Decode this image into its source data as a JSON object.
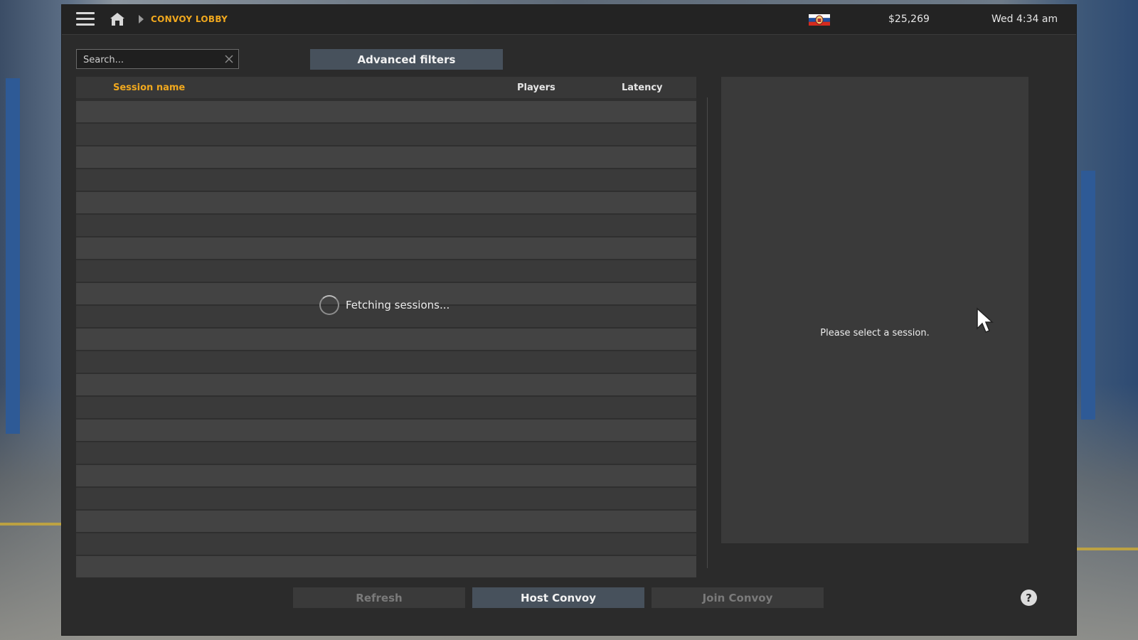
{
  "topbar": {
    "breadcrumb": "CONVOY LOBBY",
    "money": "$25,269",
    "clock": "Wed 4:34 am",
    "menu_icon": "hamburger-menu-icon",
    "home_icon": "home-icon",
    "flag_icon": "flag-icon"
  },
  "search": {
    "placeholder": "Search..."
  },
  "filters": {
    "advanced_label": "Advanced filters"
  },
  "table": {
    "columns": [
      "Session name",
      "Players",
      "Latency"
    ],
    "sorted_column": "Session name",
    "loading_text": "Fetching sessions..."
  },
  "detail": {
    "message": "Please select a session."
  },
  "actions": {
    "refresh_label": "Refresh",
    "host_label": "Host Convoy",
    "join_label": "Join Convoy",
    "help_label": "?"
  },
  "colors": {
    "accent": "#f0a81e",
    "panel": "#2b2b2b",
    "button_active": "#47515c"
  }
}
